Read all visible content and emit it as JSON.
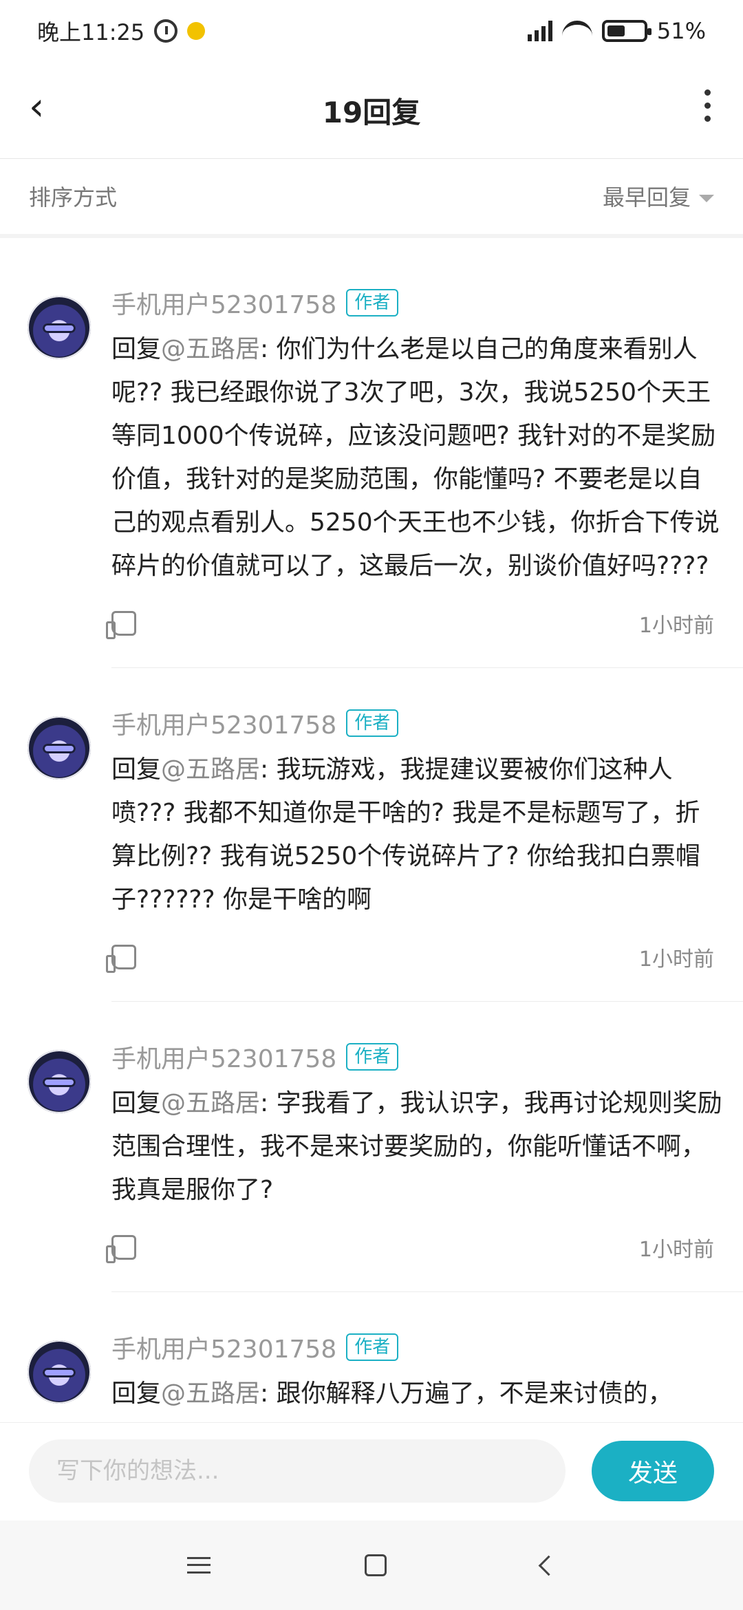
{
  "status_bar": {
    "time": "晚上11:25",
    "battery": "51%",
    "battery_level": 51
  },
  "header": {
    "title": "19回复"
  },
  "sort": {
    "label": "排序方式",
    "value": "最早回复"
  },
  "replies": [
    {
      "username": "手机用户52301758",
      "badge": "作者",
      "prefix": "回复",
      "mention": "@五路居",
      "text": ": 你们为什么老是以自己的角度来看别人呢?? 我已经跟你说了3次了吧，3次，我说5250个天王等同1000个传说碎，应该没问题吧? 我针对的不是奖励价值，我针对的是奖励范围，你能懂吗? 不要老是以自己的观点看别人。5250个天王也不少钱，你折合下传说碎片的价值就可以了，这最后一次，别谈价值好吗????",
      "time": "1小时前"
    },
    {
      "username": "手机用户52301758",
      "badge": "作者",
      "prefix": "回复",
      "mention": "@五路居",
      "text": ": 我玩游戏，我提建议要被你们这种人喷??? 我都不知道你是干啥的? 我是不是标题写了，折算比例?? 我有说5250个传说碎片了? 你给我扣白票帽子?????? 你是干啥的啊",
      "time": "1小时前"
    },
    {
      "username": "手机用户52301758",
      "badge": "作者",
      "prefix": "回复",
      "mention": "@五路居",
      "text": ": 字我看了，我认识字，我再讨论规则奖励范围合理性，我不是来讨要奖励的，你能听懂话不啊，我真是服你了?",
      "time": "1小时前"
    },
    {
      "username": "手机用户52301758",
      "badge": "作者",
      "prefix": "回复",
      "mention": "@五路居",
      "text": ": 跟你解释八万遍了，不是来讨债的，",
      "time": ""
    }
  ],
  "composer": {
    "placeholder": "写下你的想法...",
    "send_label": "发送"
  },
  "icons": {
    "back": "back-icon",
    "more": "more-vertical-icon",
    "like": "thumbs-up-icon",
    "sort_arrow": "triangle-down-icon",
    "nav_menu": "menu-icon",
    "nav_home": "home-icon",
    "nav_back": "back-nav-icon"
  },
  "colors": {
    "accent": "#1bb0c4",
    "text": "#222222",
    "muted": "#888888"
  }
}
